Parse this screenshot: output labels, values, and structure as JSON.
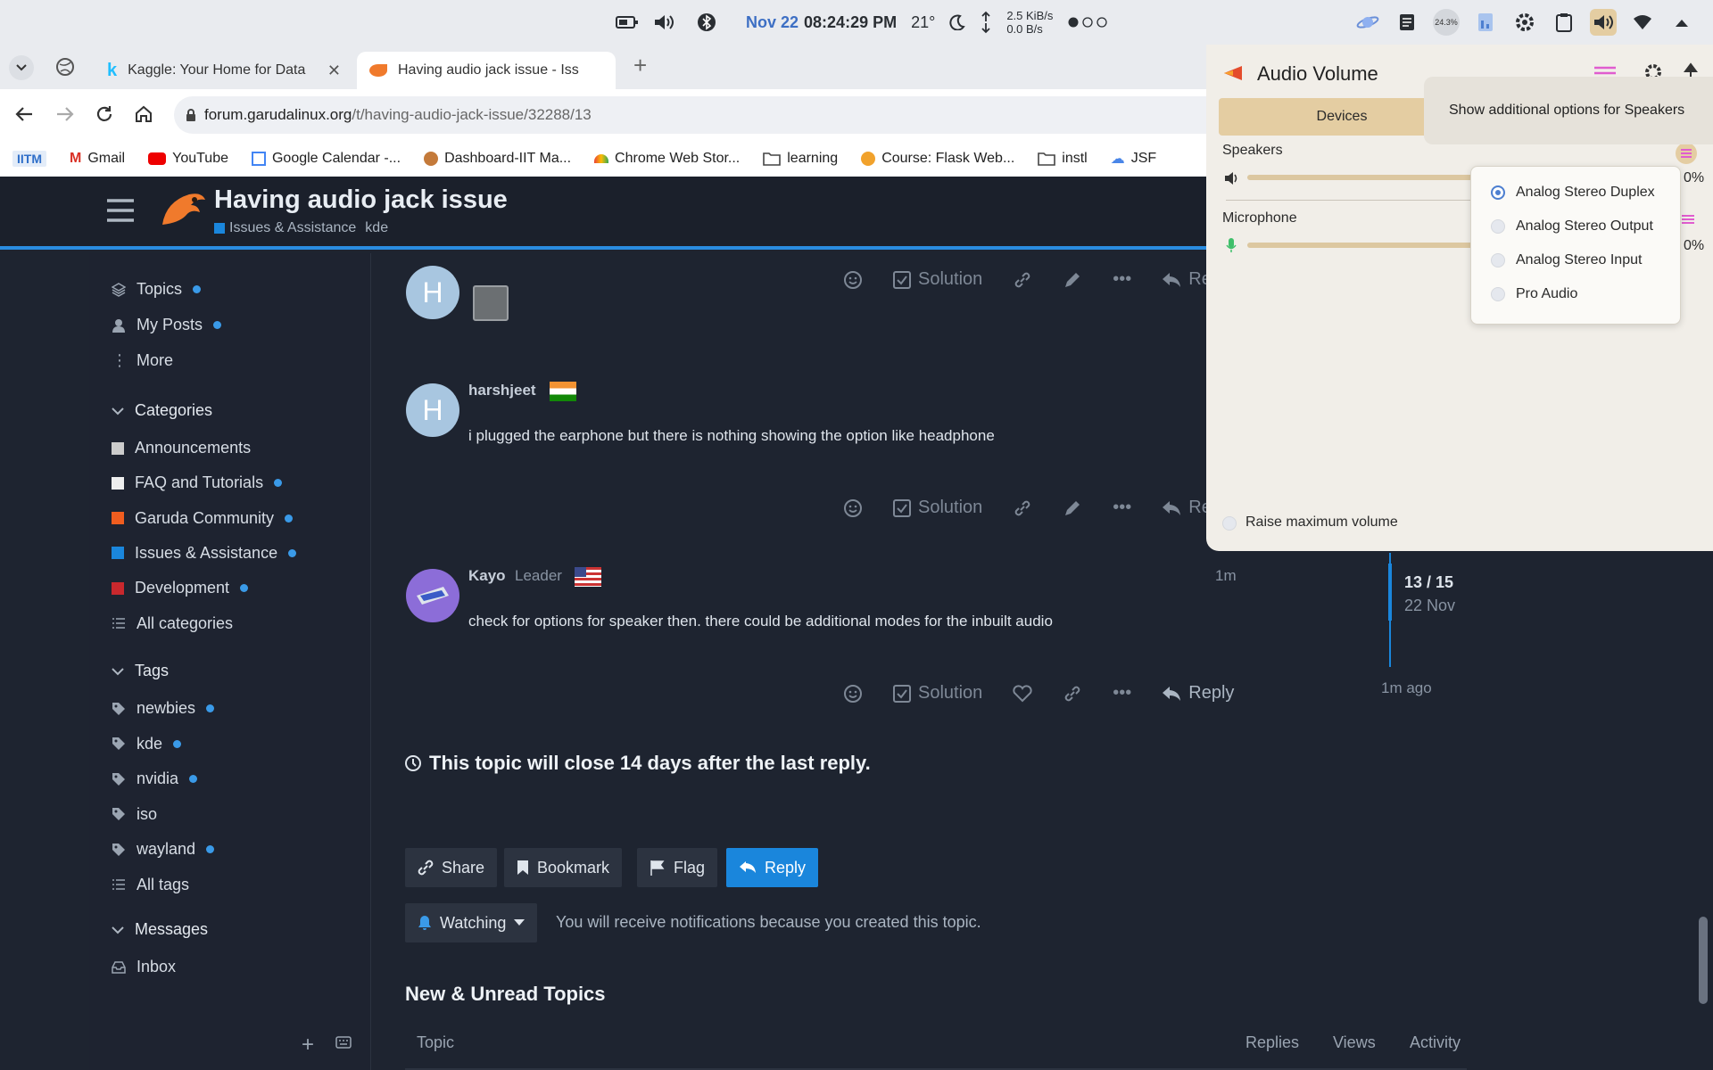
{
  "system_bar": {
    "date": "Nov 22",
    "time": "08:24:29 PM",
    "temperature": "21°",
    "net_up": "2.5 KiB/s",
    "net_down": "0.0 B/s",
    "cpu_percent": "24.3%"
  },
  "tabs": [
    {
      "title": "Kaggle: Your Home for Data",
      "icon": "kaggle-icon"
    },
    {
      "title": "Having audio jack issue - Iss",
      "icon": "garuda-icon"
    }
  ],
  "address": {
    "domain": "forum.garudalinux.org",
    "path": "/t/having-audio-jack-issue/32288/13"
  },
  "bookmarks": [
    "IITM",
    "Gmail",
    "YouTube",
    "Google Calendar -...",
    "Dashboard-IIT Ma...",
    "Chrome Web Stor...",
    "learning",
    "Course: Flask Web...",
    "instl",
    "JSF"
  ],
  "topic": {
    "title": "Having audio jack issue",
    "category": "Issues & Assistance",
    "tag": "kde"
  },
  "sidebar": {
    "nav": [
      "Topics",
      "My Posts",
      "More"
    ],
    "categories_label": "Categories",
    "categories": [
      {
        "name": "Announcements",
        "color": "#cccccc",
        "dot": false
      },
      {
        "name": "FAQ and Tutorials",
        "color": "#eeeeee",
        "dot": true
      },
      {
        "name": "Garuda Community",
        "color": "#f05d1f",
        "dot": true
      },
      {
        "name": "Issues & Assistance",
        "color": "#1a86dc",
        "dot": true
      },
      {
        "name": "Development",
        "color": "#c9282d",
        "dot": true
      },
      {
        "name": "All categories",
        "color": "",
        "dot": false
      }
    ],
    "tags_label": "Tags",
    "tags": [
      {
        "name": "newbies",
        "dot": true
      },
      {
        "name": "kde",
        "dot": true
      },
      {
        "name": "nvidia",
        "dot": true
      },
      {
        "name": "iso",
        "dot": false
      },
      {
        "name": "wayland",
        "dot": true
      },
      {
        "name": "All tags",
        "dot": false
      }
    ],
    "messages_label": "Messages",
    "inbox": "Inbox"
  },
  "posts": [
    {
      "avatar": "H",
      "user": "",
      "text": ""
    },
    {
      "avatar": "H",
      "user": "harshjeet",
      "text": "i plugged the earphone but there is nothing showing the option like headphone"
    },
    {
      "avatar": "",
      "user": "Kayo",
      "role": "Leader",
      "time": "1m",
      "text": "check for options for speaker then. there could be additional modes for the inbuilt audio"
    }
  ],
  "actions": {
    "solution": "Solution",
    "reply": "Reply",
    "reply_cut": "Re"
  },
  "timeline": {
    "position": "13 / 15",
    "date": "22 Nov",
    "ago": "1m ago"
  },
  "notice": "This topic will close 14 days after the last reply.",
  "footer_buttons": {
    "share": "Share",
    "bookmark": "Bookmark",
    "flag": "Flag",
    "reply": "Reply"
  },
  "watching": {
    "label": "Watching",
    "note": "You will receive notifications because you created this topic."
  },
  "new_topics": {
    "heading": "New & Unread Topics",
    "col_topic": "Topic",
    "col_replies": "Replies",
    "col_views": "Views",
    "col_activity": "Activity"
  },
  "audio": {
    "title": "Audio Volume",
    "tab_devices": "Devices",
    "speakers": "Speakers",
    "microphone": "Microphone",
    "pct_fragment": "0%",
    "raise_max": "Raise maximum volume",
    "tooltip": "Show additional options for Speakers",
    "menu": [
      "Analog Stereo Duplex",
      "Analog Stereo Output",
      "Analog Stereo Input",
      "Pro Audio"
    ],
    "selected": "Analog Stereo Duplex"
  }
}
